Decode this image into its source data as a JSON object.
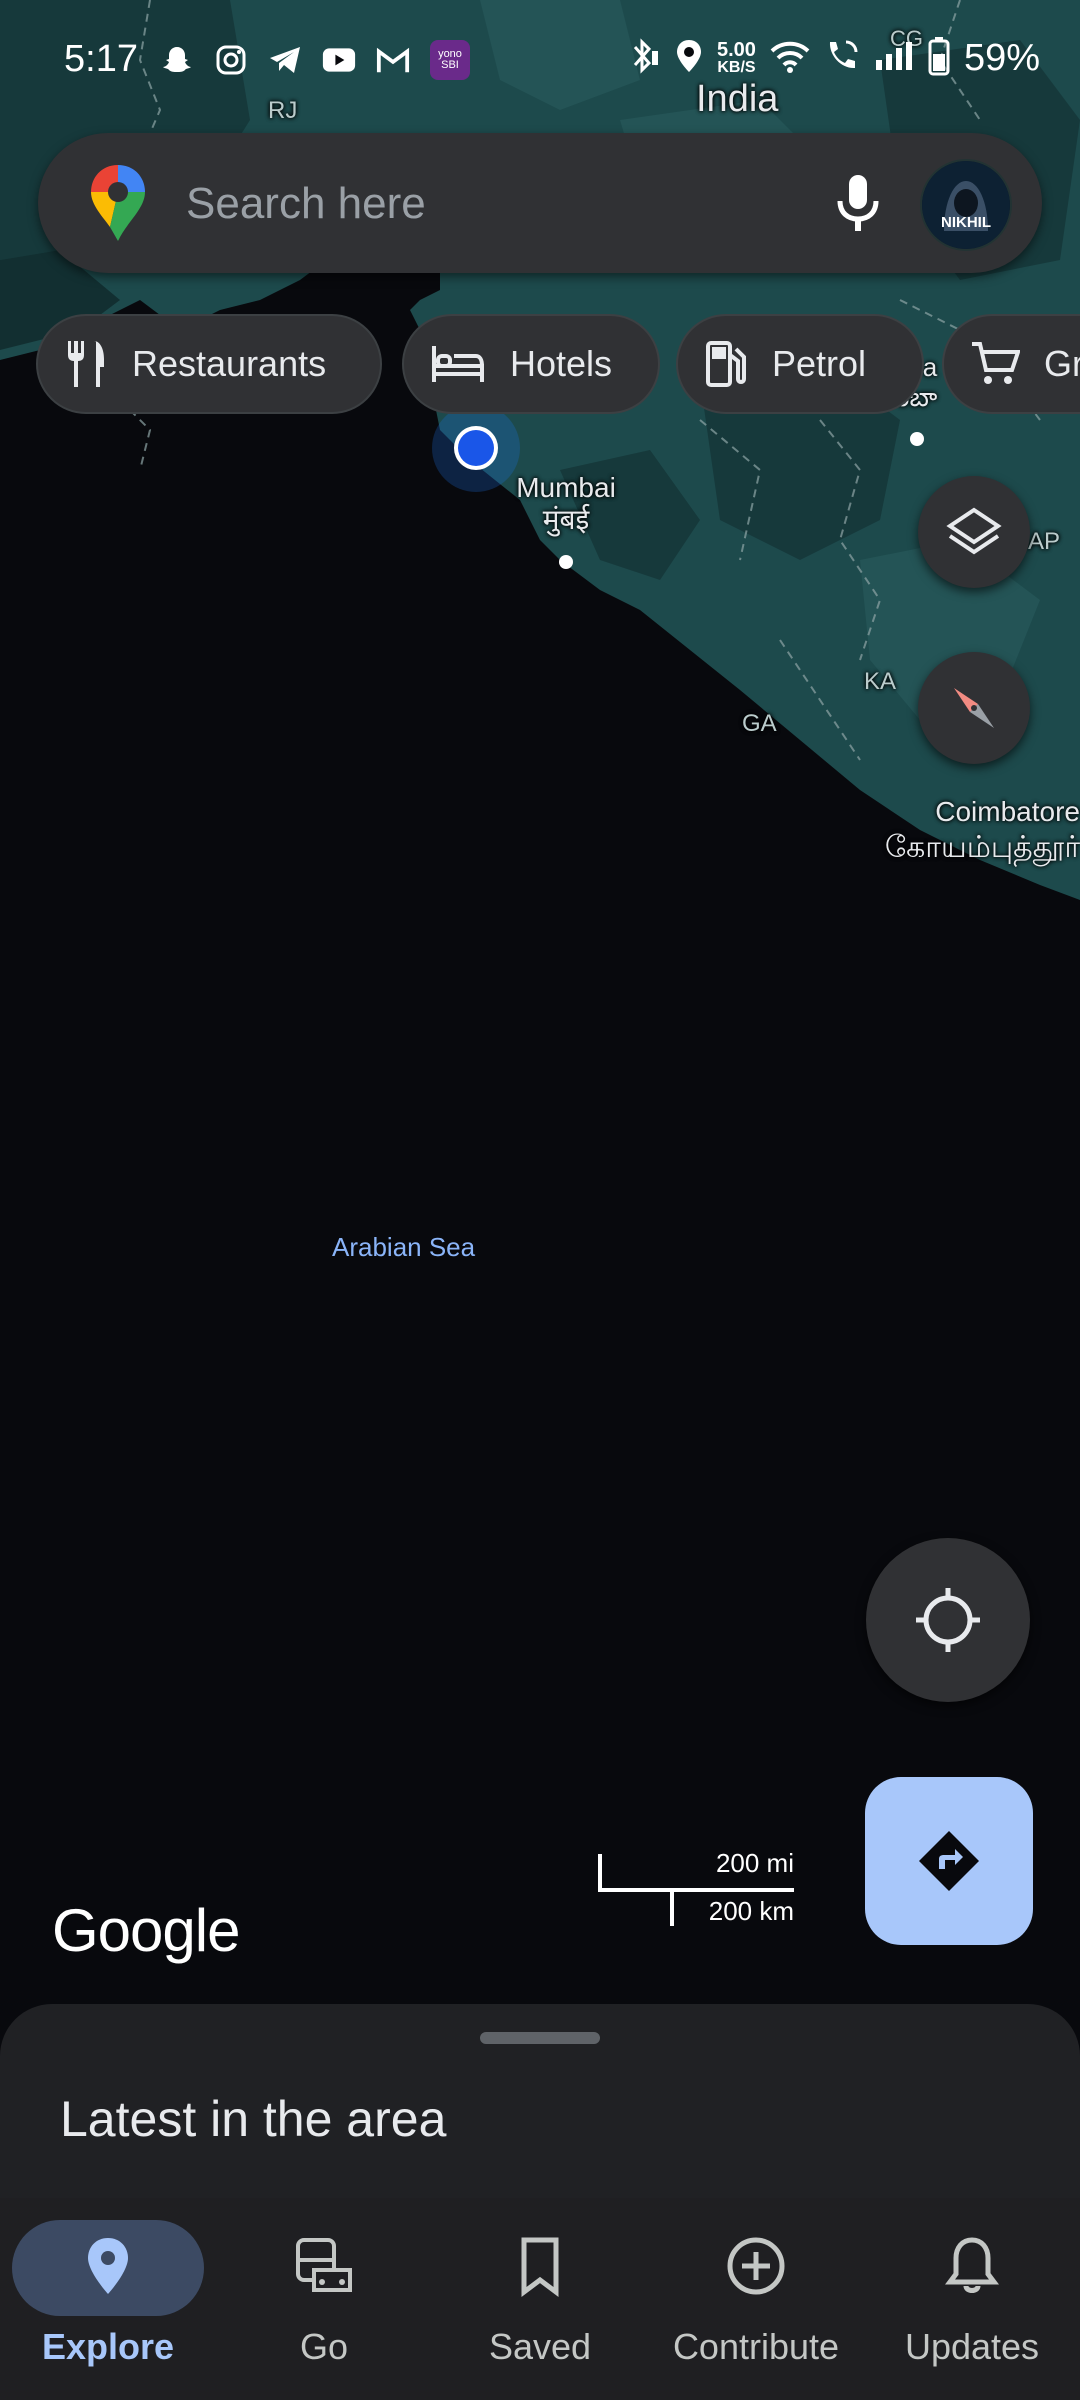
{
  "status_bar": {
    "time": "5:17",
    "yono_text": "yono SBI",
    "network_speed_value": "5.00",
    "network_speed_unit": "KB/S",
    "battery": "59%"
  },
  "map": {
    "labels": {
      "country": "India",
      "state_rj": "RJ",
      "state_ap": "AP",
      "state_ka": "KA",
      "state_ga": "GA",
      "city_mumbai": "Mumbai",
      "city_mumbai_local": "मुंबई",
      "city_coimbatore": "Coimbatore",
      "city_coimbatore_local": "கோயம்புத்தூர்",
      "city_partial": "a",
      "city_partial_local": "ఉరంబా",
      "sea": "Arabian Sea",
      "state_cg": "CG"
    },
    "scale": {
      "miles": "200 mi",
      "km": "200 km"
    },
    "logo": "Google",
    "colors": {
      "land": "#1d4a4c",
      "land_dark": "#16393b",
      "water": "#08090d",
      "location_dot": "#1a73e8"
    }
  },
  "search": {
    "placeholder": "Search here",
    "avatar_name": "NIKHIL"
  },
  "chips": [
    {
      "label": "Restaurants",
      "icon": "restaurant-icon"
    },
    {
      "label": "Hotels",
      "icon": "hotel-icon"
    },
    {
      "label": "Petrol",
      "icon": "fuel-icon"
    },
    {
      "label": "Gr",
      "icon": "cart-icon"
    }
  ],
  "sheet": {
    "title": "Latest in the area"
  },
  "bottom_nav": {
    "active_color": "#a8c7fa",
    "items": [
      {
        "label": "Explore",
        "icon": "location-pin-icon",
        "active": true
      },
      {
        "label": "Go",
        "icon": "commute-icon",
        "active": false
      },
      {
        "label": "Saved",
        "icon": "bookmark-icon",
        "active": false
      },
      {
        "label": "Contribute",
        "icon": "add-circle-icon",
        "active": false
      },
      {
        "label": "Updates",
        "icon": "bell-icon",
        "active": false
      }
    ]
  }
}
